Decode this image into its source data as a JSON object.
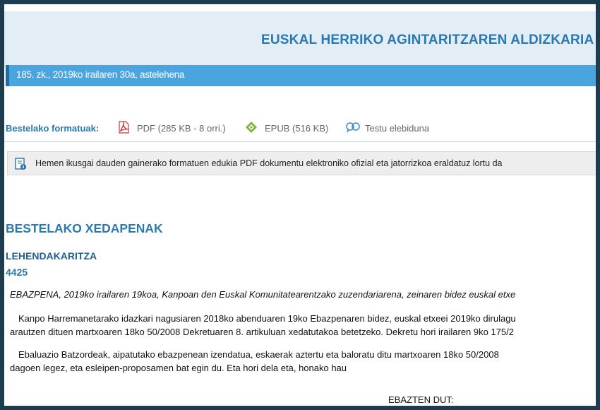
{
  "header": {
    "title": "EUSKAL HERRIKO AGINTARITZAREN ALDIZKARIA",
    "issue": "185. zk., 2019ko irailaren 30a, astelehena"
  },
  "formats": {
    "label": "Bestelako formatuak:",
    "items": [
      {
        "icon": "pdf-icon",
        "label": "PDF (285 KB - 8 orri.)"
      },
      {
        "icon": "epub-icon",
        "label": "EPUB (516 KB)"
      },
      {
        "icon": "bilingual-icon",
        "label": "Testu elebiduna"
      }
    ]
  },
  "notice": {
    "icon": "info-document-icon",
    "text": "Hemen ikusgai dauden gainerako formatuen edukia PDF dokumentu elektroniko ofizial eta jatorrizkoa eraldatuz lortu da"
  },
  "content": {
    "section": "BESTELAKO XEDAPENAK",
    "department": "LEHENDAKARITZA",
    "number": "4425",
    "summary": "EBAZPENA, 2019ko irailaren 19koa, Kanpoan den Euskal Komunitatearentzako zuzendariarena, zeinaren bidez euskal etxe",
    "paragraph1": [
      "Kanpo Harremanetarako idazkari nagusiaren 2018ko abenduaren 19ko Ebazpenaren bidez, euskal etxeei 2019ko dirulagu",
      "arautzen dituen martxoaren 18ko 50/2008 Dekretuaren 8. artikuluan xedatutakoa betetzeko. Dekretu hori irailaren 9ko 175/2"
    ],
    "paragraph2": [
      "Ebaluazio Batzordeak, aipatutako ebazpenean izendatua, eskaerak aztertu eta baloratu ditu martxoaren 18ko 50/2008",
      "dagoen legez, eta esleipen-proposamen bat egin du. Eta hori dela eta, honako hau"
    ],
    "resolve": "EBAZTEN DUT:"
  },
  "colors": {
    "accent": "#2a78b0",
    "issue_bar": "#4aa5de",
    "border": "#1f3b4e"
  }
}
